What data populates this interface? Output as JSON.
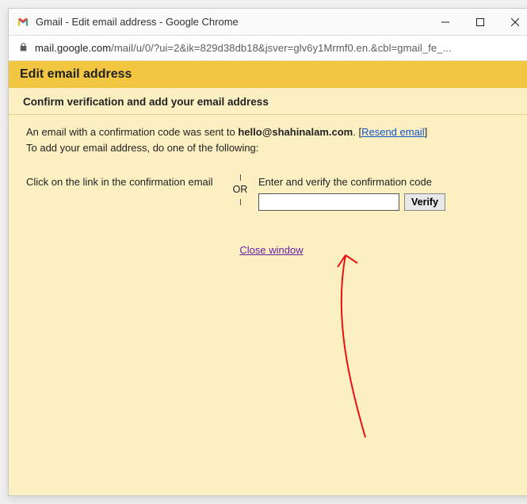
{
  "window": {
    "title": "Gmail - Edit email address - Google Chrome"
  },
  "address_bar": {
    "host": "mail.google.com",
    "path": "/mail/u/0/?ui=2&ik=829d38db18&jsver=glv6y1Mrmf0.en.&cbl=gmail_fe_..."
  },
  "page": {
    "header": "Edit email address",
    "subheader": "Confirm verification and add your email address",
    "sent_prefix": "An email with a confirmation code was sent to ",
    "sent_email": "hello@shahinalam.com",
    "resend_label": "Resend email",
    "sent_suffix_line": "To add your email address, do one of the following:",
    "option_left": "Click on the link in the confirmation email",
    "or_label": "OR",
    "option_right_label": "Enter and verify the confirmation code",
    "code_value": "",
    "verify_label": "Verify",
    "close_label": "Close window"
  }
}
